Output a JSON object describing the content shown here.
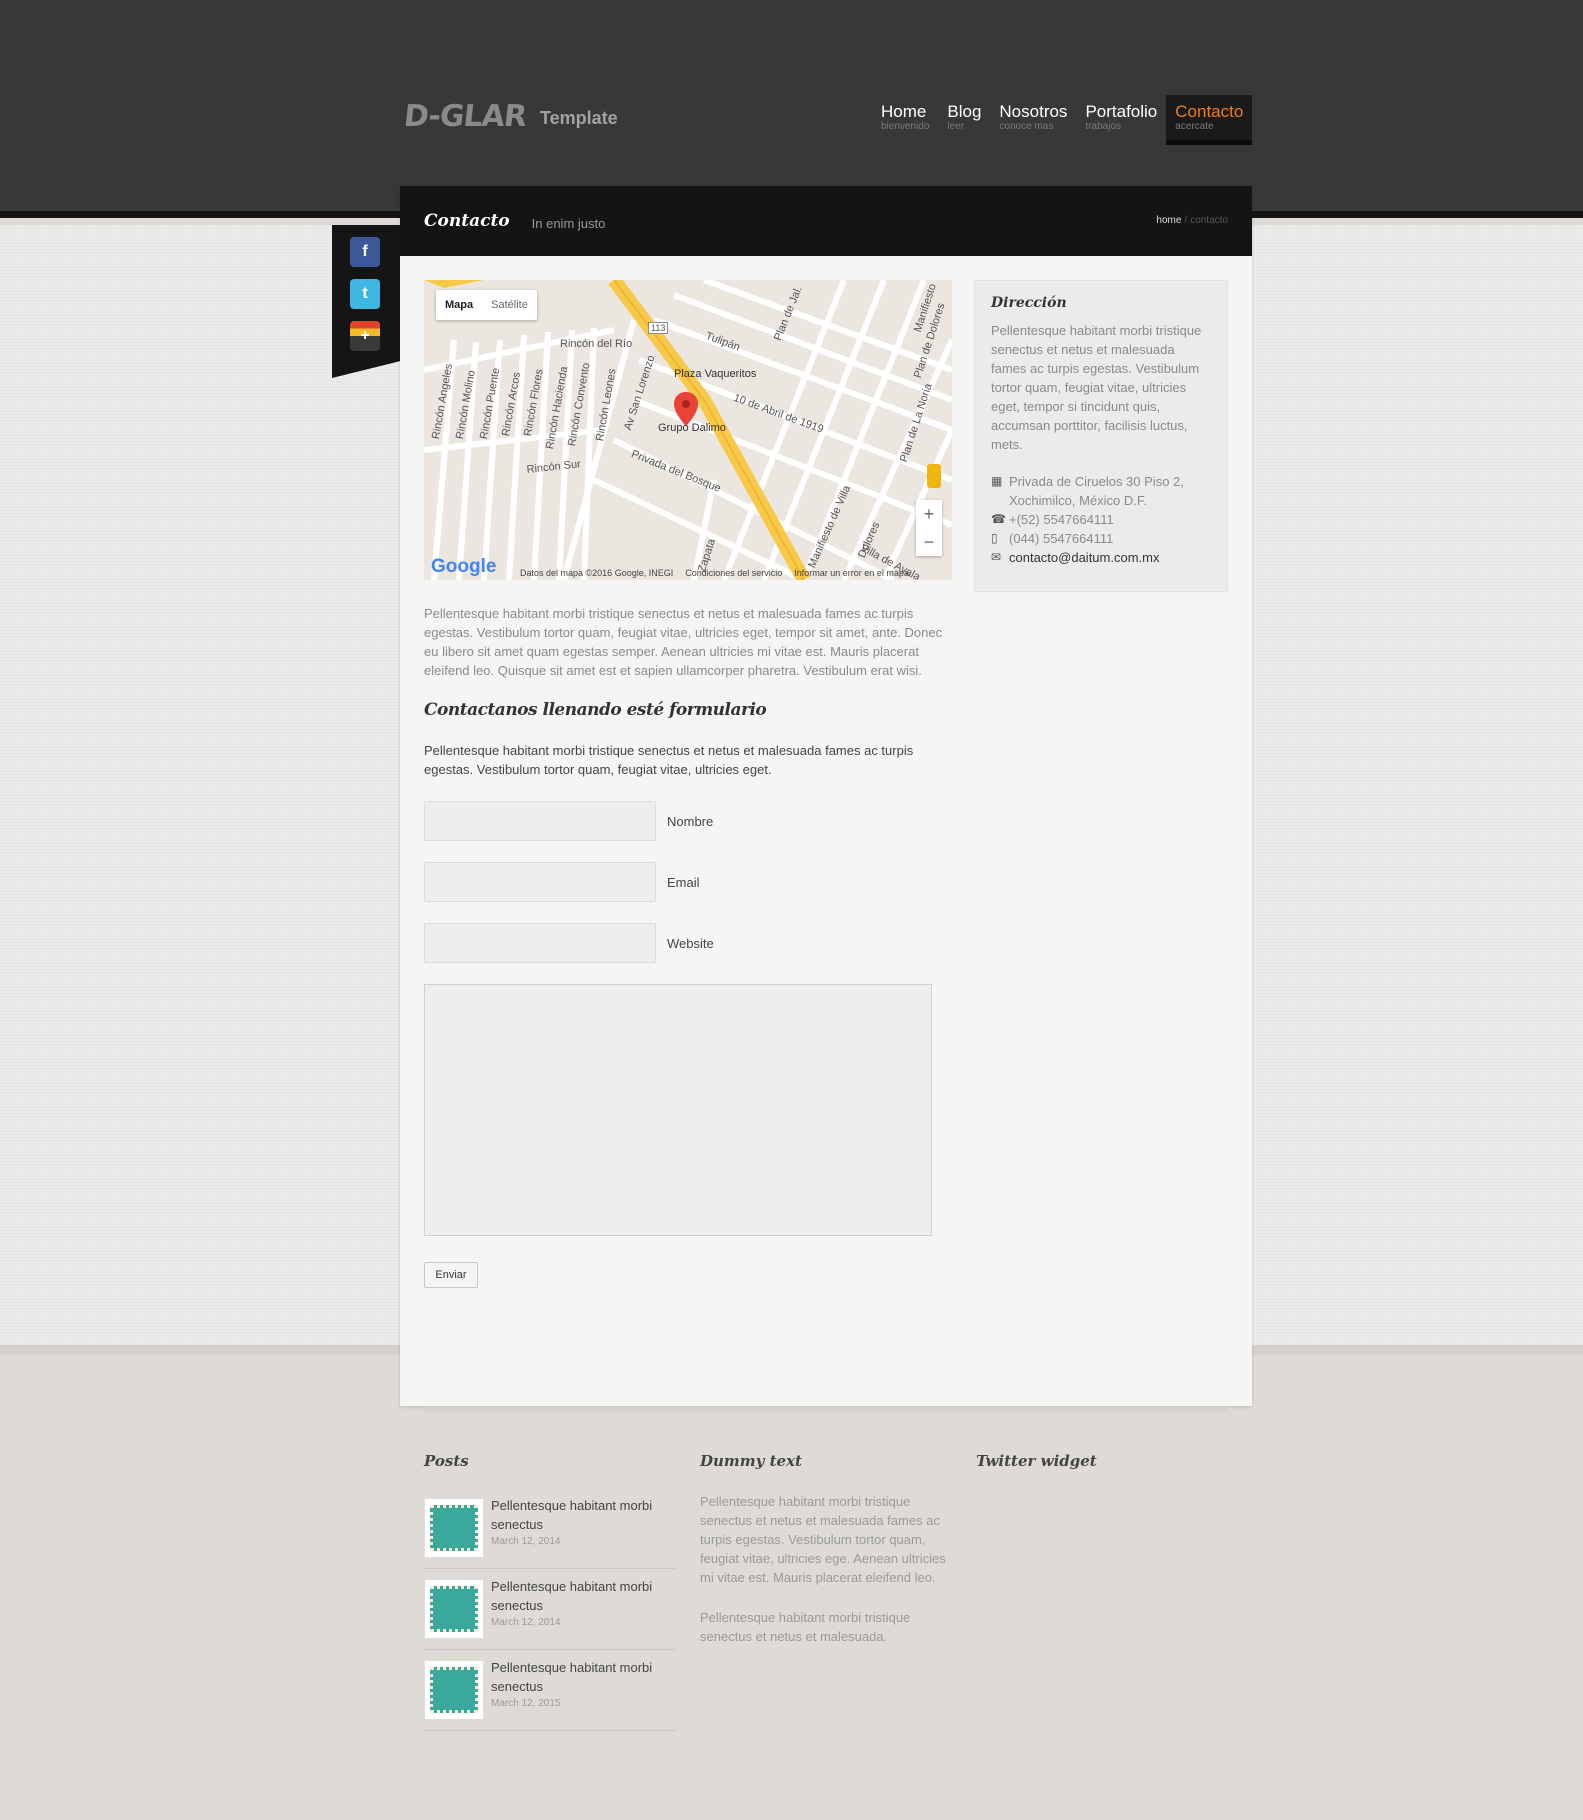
{
  "site": {
    "logo_mark": "D-GLAR",
    "logo_text": "Template"
  },
  "nav": [
    {
      "title": "Home",
      "sub": "bienvenido"
    },
    {
      "title": "Blog",
      "sub": "leer"
    },
    {
      "title": "Nosotros",
      "sub": "conoce mas"
    },
    {
      "title": "Portafolio",
      "sub": "trabajos"
    },
    {
      "title": "Contacto",
      "sub": "acercate"
    }
  ],
  "page": {
    "title": "Contacto",
    "subtitle": "In enim justo"
  },
  "breadcrumb": {
    "home": "home",
    "sep": "/",
    "current": "contacto"
  },
  "social": [
    {
      "icon": "facebook-icon",
      "glyph": "f",
      "color": "#3b5998"
    },
    {
      "icon": "twitter-icon",
      "glyph": "t",
      "color": "#3fb7e2"
    },
    {
      "icon": "plus-icon",
      "glyph": "+",
      "color": "#333"
    }
  ],
  "map": {
    "btn_map": "Mapa",
    "btn_sat": "Satélite",
    "labels": [
      "Rincón del Río",
      "Plaza Vaqueritos",
      "Grupo Dalimo",
      "10 de Abril de 1919",
      "Tulipán",
      "Plan de Jal.",
      "Plan de Dolores",
      "Manifiesto",
      "Plan de La Noria",
      "Av San Lorenzo",
      "Privada del Bosque",
      "Rincón Sur",
      "Rincón Angeles",
      "Rincón Molino",
      "Rincón Puente",
      "Rincón Arcos",
      "Rincón Flores",
      "Rincón Hacienda",
      "Rincón Convento",
      "Rincón Leones",
      "Manifiesto de Villa",
      "Dolores",
      "Villa de Ayala",
      "Zapata",
      "113"
    ],
    "attribution": "Datos del mapa ©2016 Google, INEGI",
    "terms": "Condiciones del servicio",
    "report": "Informar un error en el mapa",
    "google": "Google"
  },
  "intro": "Pellentesque habitant morbi tristique senectus et netus et malesuada fames ac turpis egestas. Vestibulum tortor quam, feugiat vitae, ultricies eget, tempor sit amet, ante. Donec eu libero sit amet quam egestas semper. Aenean ultricies mi vitae est. Mauris placerat eleifend leo. Quisque sit amet est et sapien ullamcorper pharetra. Vestibulum erat wisi.",
  "form": {
    "heading": "Contactanos llenando esté formulario",
    "intro": "Pellentesque habitant morbi tristique senectus et netus et malesuada fames ac turpis egestas. Vestibulum tortor quam, feugiat vitae, ultricies eget.",
    "name_label": "Nombre",
    "email_label": "Email",
    "website_label": "Website",
    "send": "Enviar"
  },
  "address": {
    "heading": "Dirección",
    "text": "Pellentesque habitant morbi tristique senectus et netus et malesuada fames ac turpis egestas. Vestibulum tortor quam, feugiat vitae, ultricies eget, tempor si tincidunt quis, accumsan porttitor, facilisis luctus, mets.",
    "street": "Privada de Ciruelos 30 Piso 2,",
    "city": "Xochimilco, México D.F.",
    "phone": "+(52) 5547664111",
    "mobile": "(044) 5547664111",
    "email": "contacto@daitum.com.mx"
  },
  "footer": {
    "posts_heading": "Posts",
    "posts": [
      {
        "title": "Pellentesque habitant morbi senectus",
        "date": "March 12, 2014"
      },
      {
        "title": "Pellentesque habitant morbi senectus",
        "date": "March 12, 2014"
      },
      {
        "title": "Pellentesque habitant morbi senectus",
        "date": "March 12, 2015"
      }
    ],
    "dummy_heading": "Dummy text",
    "dummy_p1": "Pellentesque habitant morbi tristique senectus et netus et malesuada fames ac turpis egestas. Vestibulum tortor quam, feugiat vitae, ultricies ege. Aenean ultricies mi vitae est. Mauris placerat eleifend leo.",
    "dummy_p2": "Pellentesque habitant morbi tristique senectus et netus et malesuada.",
    "twitter_heading": "Twitter widget"
  },
  "colors": {
    "accent": "#f07c1c",
    "header": "#363839",
    "band": "#141414"
  }
}
